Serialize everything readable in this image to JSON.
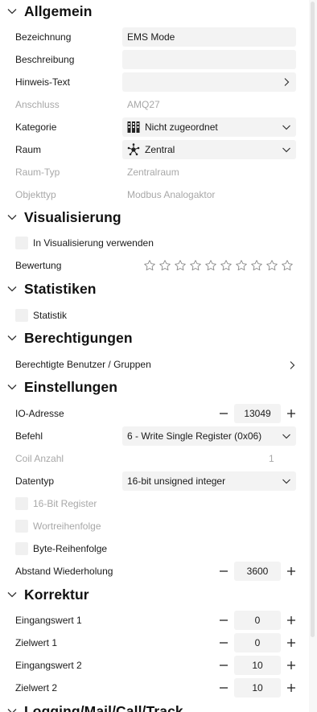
{
  "sections": {
    "allgemein": "Allgemein",
    "visualisierung": "Visualisierung",
    "statistiken": "Statistiken",
    "berechtigungen": "Berechtigungen",
    "einstellungen": "Einstellungen",
    "korrektur": "Korrektur",
    "logging": "Logging/Mail/Call/Track"
  },
  "general": {
    "bezeichnung_label": "Bezeichnung",
    "bezeichnung_value": "EMS Mode",
    "beschreibung_label": "Beschreibung",
    "beschreibung_value": "",
    "hinweis_label": "Hinweis-Text",
    "anschluss_label": "Anschluss",
    "anschluss_value": "AMQ27",
    "kategorie_label": "Kategorie",
    "kategorie_value": "Nicht zugeordnet",
    "raum_label": "Raum",
    "raum_value": "Zentral",
    "raumtyp_label": "Raum-Typ",
    "raumtyp_value": "Zentralraum",
    "objekttyp_label": "Objekttyp",
    "objekttyp_value": "Modbus Analogaktor"
  },
  "visualisation": {
    "use_label": "In Visualisierung verwenden",
    "rating_label": "Bewertung",
    "rating_max": 10,
    "rating_value": 0
  },
  "statistics": {
    "statistik_label": "Statistik"
  },
  "permissions": {
    "users_label": "Berechtigte Benutzer / Gruppen"
  },
  "settings": {
    "io_label": "IO-Adresse",
    "io_value": "13049",
    "befehl_label": "Befehl",
    "befehl_value": "6 - Write Single Register (0x06)",
    "coil_label": "Coil Anzahl",
    "coil_value": "1",
    "datentyp_label": "Datentyp",
    "datentyp_value": "16-bit unsigned integer",
    "reg16_label": "16-Bit Register",
    "wort_label": "Wortreihenfolge",
    "byte_label": "Byte-Reihenfolge",
    "abstand_label": "Abstand Wiederholung",
    "abstand_value": "3600"
  },
  "correction": {
    "ein1_label": "Eingangswert 1",
    "ein1_value": "0",
    "ziel1_label": "Zielwert 1",
    "ziel1_value": "0",
    "ein2_label": "Eingangswert 2",
    "ein2_value": "10",
    "ziel2_label": "Zielwert 2",
    "ziel2_value": "10"
  },
  "icons": {
    "section_toggle": "chevron-down-icon",
    "field_open": "chevron-right-icon",
    "dropdown": "chevron-down-icon",
    "kategorie": "category-blocks-icon",
    "raum": "room-star-icon",
    "rating": "star-outline-icon",
    "decrement": "minus-icon",
    "increment": "plus-icon"
  }
}
